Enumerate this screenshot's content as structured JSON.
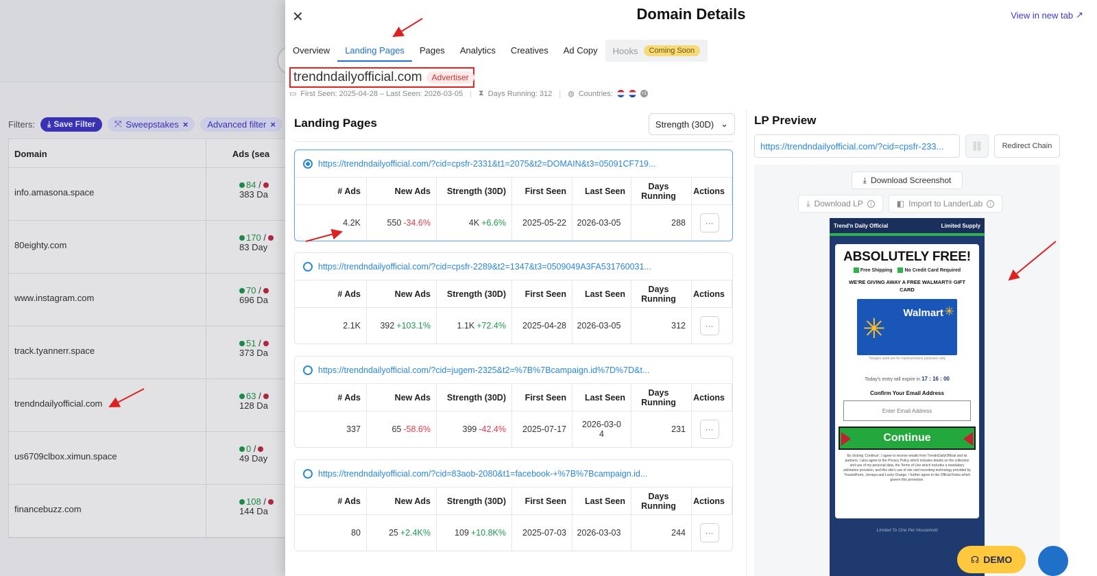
{
  "background": {
    "filters_label": "Filters:",
    "save_filter": "Save Filter",
    "chips": [
      "Sweepstakes",
      "Advanced filter"
    ],
    "chip_close": "×",
    "table_headers": {
      "domain": "Domain",
      "ads": "Ads (sea"
    },
    "rows": [
      {
        "domain": "info.amasona.space",
        "ads_live": "84",
        "ads_sep": "/",
        "days": "383 Da"
      },
      {
        "domain": "80eighty.com",
        "ads_live": "170",
        "ads_sep": "/",
        "days": "83 Day"
      },
      {
        "domain": "www.instagram.com",
        "ads_live": "70",
        "ads_sep": "/",
        "days": "696 Da"
      },
      {
        "domain": "track.tyannerr.space",
        "ads_live": "51",
        "ads_sep": "/",
        "days": "373 Da"
      },
      {
        "domain": "trendndailyofficial.com",
        "ads_live": "63",
        "ads_sep": "/",
        "days": "128 Da"
      },
      {
        "domain": "us6709clbox.ximun.space",
        "ads_live": "0",
        "ads_sep": "/",
        "days": "49 Day"
      },
      {
        "domain": "financebuzz.com",
        "ads_live": "108",
        "ads_sep": "/",
        "days": "144 Da"
      }
    ]
  },
  "drawer": {
    "close": "✕",
    "title": "Domain Details",
    "view_new_tab": "View in new tab",
    "tabs": [
      "Overview",
      "Landing Pages",
      "Pages",
      "Analytics",
      "Creatives",
      "Ad Copy"
    ],
    "tab_hooks": "Hooks",
    "coming_soon": "Coming Soon",
    "domain": "trendndailyofficial.com",
    "badge": "Advertiser",
    "first_seen": "First Seen: 2025-04-28 – Last Seen: 2026-03-05",
    "days_running": "Days Running: 312",
    "countries": "Countries:",
    "more_countries": "+1"
  },
  "landing_pages": {
    "title": "Landing Pages",
    "sort": "Strength (30D)",
    "headers": [
      "# Ads",
      "New Ads",
      "Strength (30D)",
      "First Seen",
      "Last Seen",
      "Days Running",
      "Actions"
    ],
    "items": [
      {
        "url": "https://trendndailyofficial.com/?cid=cpsfr-2331&t1=2075&t2=DOMAIN&t3=05091CF719...",
        "ads": "4.2K",
        "new_ads": "550",
        "new_change": "-34.6%",
        "strength": "4K",
        "strength_change": "+6.6%",
        "first_seen": "2025-05-22",
        "last_seen": "2026-03-05",
        "days": "288"
      },
      {
        "url": "https://trendndailyofficial.com/?cid=cpsfr-2289&t2=1347&t3=0509049A3FA531760031...",
        "ads": "2.1K",
        "new_ads": "392",
        "new_change": "+103.1%",
        "strength": "1.1K",
        "strength_change": "+72.4%",
        "first_seen": "2025-04-28",
        "last_seen": "2026-03-05",
        "days": "312"
      },
      {
        "url": "https://trendndailyofficial.com/?cid=jugem-2325&t2=%7B%7Bcampaign.id%7D%7D&t...",
        "ads": "337",
        "new_ads": "65",
        "new_change": "-58.6%",
        "strength": "399",
        "strength_change": "-42.4%",
        "first_seen": "2025-07-17",
        "last_seen": "2026-03-04",
        "days": "231"
      },
      {
        "url": "https://trendndailyofficial.com/?cid=83aob-2080&t1=facebook-+%7B%7Bcampaign.id...",
        "ads": "80",
        "new_ads": "25",
        "new_change": "+2.4K%",
        "strength": "109",
        "strength_change": "+10.8K%",
        "first_seen": "2025-07-03",
        "last_seen": "2026-03-03",
        "days": "244"
      }
    ]
  },
  "preview": {
    "title": "LP Preview",
    "url": "https://trendndailyofficial.com/?cid=cpsfr-233...",
    "redirect_chain": "Redirect Chain",
    "download_screenshot": "Download Screenshot",
    "download_lp": "Download LP",
    "import_landerlab": "Import to LanderLab",
    "lp": {
      "brand": "Trend'n Daily Official",
      "limited": "Limited Supply",
      "headline": "ABSOLUTELY FREE!",
      "check1": "Free Shipping",
      "check2": "No Credit Card Required",
      "sub": "WE'RE GIVING AWAY A FREE WALMART® GIFT CARD",
      "walmart": "Walmart",
      "card_note": "*images used are for representation purposes only",
      "timer_label": "Today's entry will expire in",
      "timer": "17 : 16 : 00",
      "confirm": "Confirm Your Email Address",
      "email_placeholder": "Enter Email Address",
      "continue": "Continue",
      "legal": "By clicking 'Continue', I agree to receive emails from TrendnDailyOfficial and its partners. I also agree to the Privacy Policy which includes details on the collection and use of my personal data, the Terms of Use which includes a mandatory arbitration provision, and this site's use of site visit recording technology provided by TrustedForm, Jornaya and Lucky Orange. I further agree to the Official Rules which govern this promotion.",
      "footer": "Limited To One Per Household"
    }
  },
  "demo": "DEMO",
  "colors": {
    "accent": "#1e70c8",
    "brand": "#3f37c9",
    "positive": "#1d9a4d",
    "negative": "#e0394a",
    "annotation": "#e02020"
  }
}
